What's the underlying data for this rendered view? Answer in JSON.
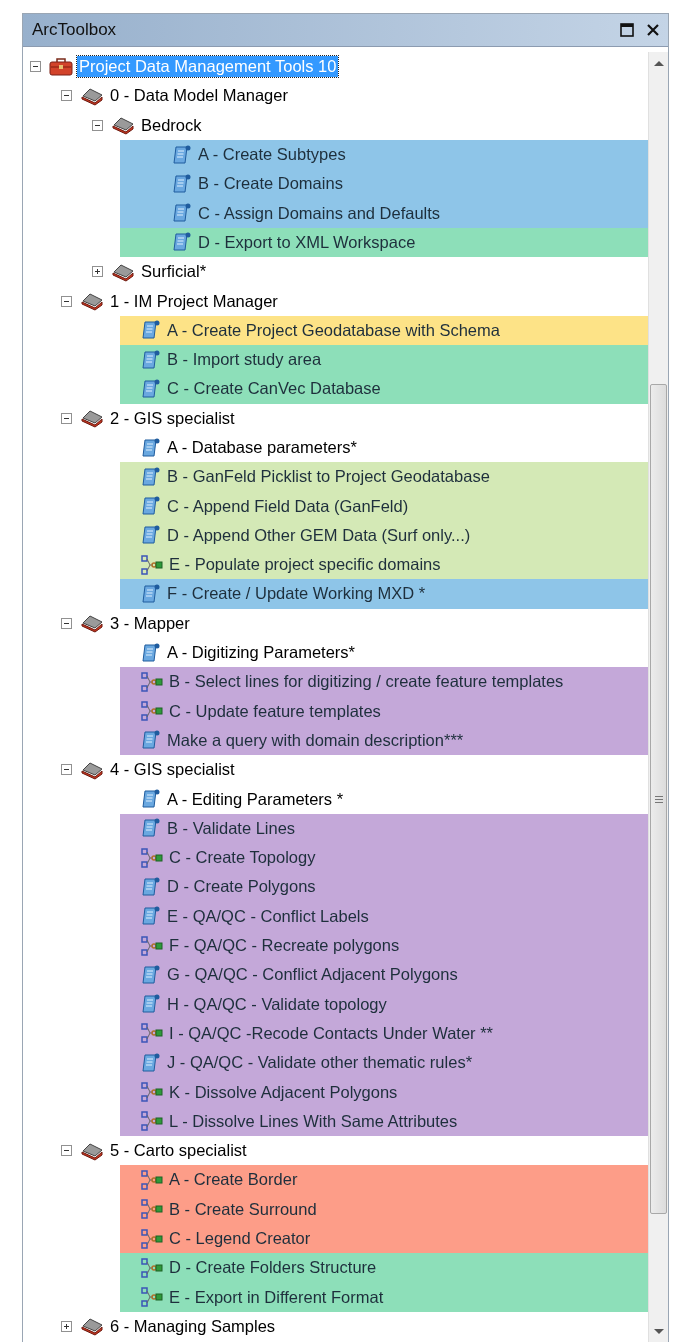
{
  "panel": {
    "title": "ArcToolbox"
  },
  "tree": [
    {
      "label": "Project Data Management Tools 10",
      "kind": "toolbox",
      "expanded": true,
      "selected": true,
      "children": [
        {
          "label": "0 - Data Model Manager",
          "kind": "toolset",
          "expanded": true,
          "selected": false,
          "children": [
            {
              "label": "Bedrock",
              "kind": "toolset",
              "expanded": true,
              "selected": false,
              "children": [
                {
                  "label": "A - Create Subtypes",
                  "kind": "script",
                  "selected": false,
                  "color": "#8ec5e8"
                },
                {
                  "label": "B - Create Domains",
                  "kind": "script",
                  "selected": false,
                  "color": "#8ec5e8"
                },
                {
                  "label": "C - Assign Domains and Defaults",
                  "kind": "script",
                  "selected": false,
                  "color": "#8ec5e8"
                },
                {
                  "label": "D - Export to XML Workspace",
                  "kind": "script",
                  "selected": false,
                  "color": "#8ddfb9"
                }
              ]
            },
            {
              "label": "Surficial*",
              "kind": "toolset",
              "expanded": false,
              "selected": false
            }
          ]
        },
        {
          "label": "1 - IM Project Manager",
          "kind": "toolset",
          "expanded": true,
          "selected": false,
          "children": [
            {
              "label": "A - Create Project Geodatabase with Schema",
              "kind": "script",
              "selected": false,
              "color": "#fde387"
            },
            {
              "label": "B - Import study area",
              "kind": "script",
              "selected": false,
              "color": "#8ddfb9"
            },
            {
              "label": "C - Create CanVec Database",
              "kind": "script",
              "selected": false,
              "color": "#8ddfb9"
            }
          ]
        },
        {
          "label": "2 - GIS specialist",
          "kind": "toolset",
          "expanded": true,
          "selected": false,
          "children": [
            {
              "label": "A - Database parameters*",
              "kind": "script",
              "selected": false
            },
            {
              "label": "B - GanFeld Picklist to Project Geodatabase",
              "kind": "script",
              "selected": false,
              "color": "#d4e9b6"
            },
            {
              "label": "C - Append Field Data (GanFeld)",
              "kind": "script",
              "selected": false,
              "color": "#d4e9b6"
            },
            {
              "label": "D - Append Other GEM Data (Surf only...)",
              "kind": "script",
              "selected": false,
              "color": "#d4e9b6"
            },
            {
              "label": "E - Populate project specific domains",
              "kind": "model",
              "selected": false,
              "color": "#d4e9b6"
            },
            {
              "label": "F - Create / Update Working MXD *",
              "kind": "script",
              "selected": false,
              "color": "#8ec5e8"
            }
          ]
        },
        {
          "label": "3 - Mapper",
          "kind": "toolset",
          "expanded": true,
          "selected": false,
          "children": [
            {
              "label": "A - Digitizing Parameters*",
              "kind": "script",
              "selected": false
            },
            {
              "label": "B - Select lines for digitizing / create feature templates",
              "kind": "model",
              "selected": false,
              "color": "#c4a8d9"
            },
            {
              "label": "C - Update feature templates",
              "kind": "model",
              "selected": false,
              "color": "#c4a8d9"
            },
            {
              "label": "Make a query with domain description***",
              "kind": "script",
              "selected": false,
              "color": "#c4a8d9"
            }
          ]
        },
        {
          "label": "4 - GIS specialist",
          "kind": "toolset",
          "expanded": true,
          "selected": false,
          "children": [
            {
              "label": "A - Editing Parameters *",
              "kind": "script",
              "selected": false
            },
            {
              "label": "B - Validate Lines",
              "kind": "script",
              "selected": false,
              "color": "#c4a8d9"
            },
            {
              "label": "C - Create Topology",
              "kind": "model",
              "selected": false,
              "color": "#c4a8d9"
            },
            {
              "label": "D - Create Polygons",
              "kind": "script",
              "selected": false,
              "color": "#c4a8d9"
            },
            {
              "label": "E - QA/QC - Conflict Labels",
              "kind": "script",
              "selected": false,
              "color": "#c4a8d9"
            },
            {
              "label": "F - QA/QC - Recreate polygons",
              "kind": "model",
              "selected": false,
              "color": "#c4a8d9"
            },
            {
              "label": "G - QA/QC - Conflict Adjacent Polygons",
              "kind": "script",
              "selected": false,
              "color": "#c4a8d9"
            },
            {
              "label": "H - QA/QC - Validate topology",
              "kind": "script",
              "selected": false,
              "color": "#c4a8d9"
            },
            {
              "label": "I - QA/QC -Recode Contacts Under Water **",
              "kind": "model",
              "selected": false,
              "color": "#c4a8d9"
            },
            {
              "label": "J - QA/QC - Validate other thematic rules*",
              "kind": "script",
              "selected": false,
              "color": "#c4a8d9"
            },
            {
              "label": "K - Dissolve Adjacent Polygons",
              "kind": "model",
              "selected": false,
              "color": "#c4a8d9"
            },
            {
              "label": "L - Dissolve Lines With Same Attributes",
              "kind": "model",
              "selected": false,
              "color": "#c4a8d9"
            }
          ]
        },
        {
          "label": "5 - Carto specialist",
          "kind": "toolset",
          "expanded": true,
          "selected": false,
          "children": [
            {
              "label": "A - Create Border",
              "kind": "model",
              "selected": false,
              "color": "#fd9d88"
            },
            {
              "label": "B - Create Surround",
              "kind": "model",
              "selected": false,
              "color": "#fd9d88"
            },
            {
              "label": "C - Legend Creator",
              "kind": "model",
              "selected": false,
              "color": "#fd9d88"
            },
            {
              "label": "D - Create Folders Structure",
              "kind": "model",
              "selected": false,
              "color": "#8ddfb9"
            },
            {
              "label": "E - Export in Different Format",
              "kind": "model",
              "selected": false,
              "color": "#8ddfb9"
            }
          ]
        },
        {
          "label": "6 - Managing Samples",
          "kind": "toolset",
          "expanded": false,
          "selected": false
        }
      ]
    }
  ]
}
